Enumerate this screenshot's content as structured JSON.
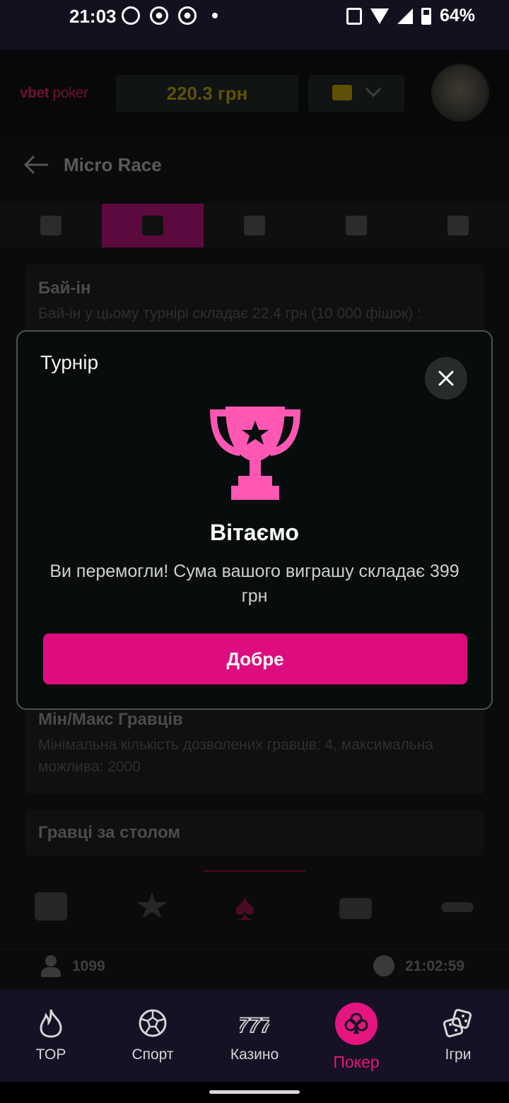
{
  "status_bar": {
    "time": "21:03",
    "battery": "64%"
  },
  "header": {
    "logo_brand": "vbet",
    "logo_product": "poker",
    "balance": "220.3 грн"
  },
  "page": {
    "title": "Micro Race"
  },
  "cards": {
    "buyin_title": "Бай-ін",
    "buyin_text": "Бай-ін у цьому турнірі складає 22.4 грн (10 000 фішок) :",
    "players_title": "Мін/Макс Гравців",
    "players_text": "Мінімальна кількість дозволених гравців: 4, максимальна можлива: 2000",
    "table_title": "Гравці за столом"
  },
  "info_row": {
    "player_count": "1099",
    "clock": "21:02:59"
  },
  "modal": {
    "title": "Турнір",
    "heading": "Вітаємо",
    "message": "Ви перемогли! Сума вашого виграшу складає 399 грн",
    "button": "Добре",
    "accent": "#ff57b3"
  },
  "nav": {
    "items": [
      {
        "label": "TOP",
        "icon": "flame-icon"
      },
      {
        "label": "Спорт",
        "icon": "soccer-ball-icon"
      },
      {
        "label": "Казино",
        "icon": "slots-777-icon"
      },
      {
        "label": "Покер",
        "icon": "club-icon"
      },
      {
        "label": "Ігри",
        "icon": "dice-icon"
      }
    ],
    "active_color": "#e5157f"
  }
}
